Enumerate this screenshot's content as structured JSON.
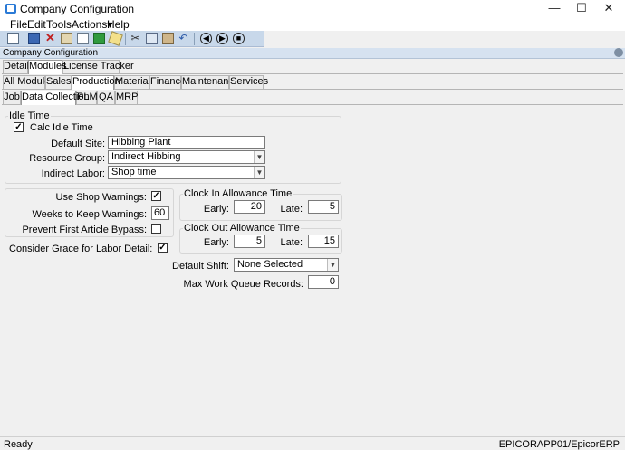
{
  "window": {
    "title": "Company Configuration",
    "minimize_glyph": "—",
    "maximize_glyph": "☐",
    "close_glyph": "✕"
  },
  "menu": [
    "File",
    "Edit",
    "Tools",
    "Actions▾",
    "Help"
  ],
  "form_title": "Company Configuration",
  "tabs_level1": [
    "Detail",
    "Modules",
    "License Tracker"
  ],
  "tabs_level2": [
    "All Modules",
    "Sales",
    "Production",
    "Materials",
    "Finance",
    "Maintenance",
    "Services"
  ],
  "tabs_level3": [
    "Job",
    "Data Collection",
    "PLM",
    "QA",
    "MRP"
  ],
  "idle": {
    "group_label": "Idle Time",
    "calc_label": "Calc Idle Time",
    "calc_checked": true,
    "default_site_label": "Default Site:",
    "default_site_value": "Hibbing Plant",
    "resource_group_label": "Resource Group:",
    "resource_group_value": "Indirect Hibbing",
    "indirect_labor_label": "Indirect Labor:",
    "indirect_labor_value": "Shop time"
  },
  "shop": {
    "use_warnings_label": "Use Shop Warnings:",
    "use_warnings_checked": true,
    "weeks_label": "Weeks to Keep Warnings:",
    "weeks_value": "60",
    "prevent_label": "Prevent First Article Bypass:",
    "prevent_checked": false,
    "grace_label": "Consider Grace for Labor Detail:",
    "grace_checked": true
  },
  "clock_in": {
    "group_label": "Clock In Allowance Time",
    "early_label": "Early:",
    "early_value": "20",
    "late_label": "Late:",
    "late_value": "5"
  },
  "clock_out": {
    "group_label": "Clock Out Allowance Time",
    "early_label": "Early:",
    "early_value": "5",
    "late_label": "Late:",
    "late_value": "15"
  },
  "default_shift_label": "Default Shift:",
  "default_shift_value": "None Selected",
  "max_queue_label": "Max Work Queue Records:",
  "max_queue_value": "0",
  "status": {
    "left": "Ready",
    "right": "EPICORAPP01/EpicorERP"
  },
  "colors": {
    "toolbar_bg": "#c8d8ea",
    "form_title_bg": "#d6e2f0",
    "window_icon": "#2a7ad6"
  },
  "icons": [
    "new-icon",
    "save-icon",
    "delete-icon",
    "print-icon",
    "copy-icon",
    "refresh-icon",
    "clear-icon",
    "cut-icon",
    "copy-clip-icon",
    "paste-icon",
    "undo-icon",
    "back-icon",
    "forward-icon",
    "stop-icon"
  ]
}
